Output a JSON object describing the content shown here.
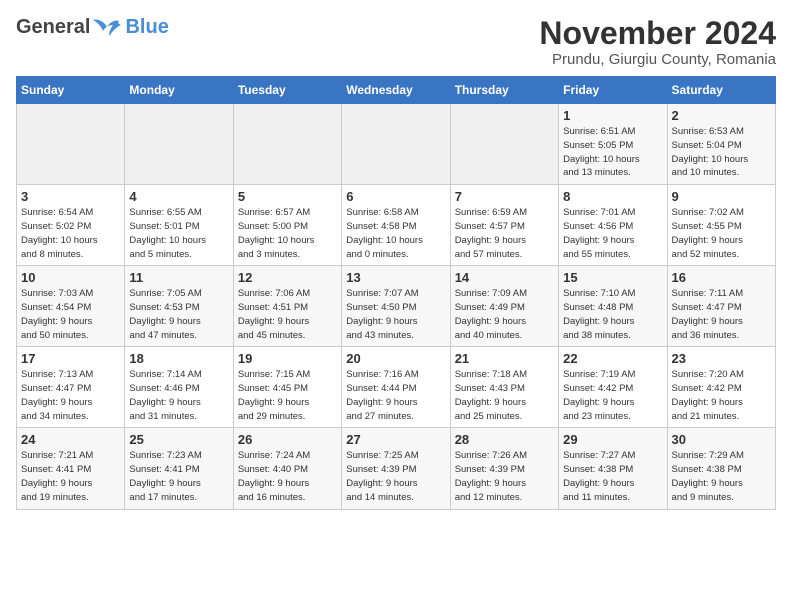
{
  "header": {
    "logo_general": "General",
    "logo_blue": "Blue",
    "month_title": "November 2024",
    "location": "Prundu, Giurgiu County, Romania"
  },
  "weekdays": [
    "Sunday",
    "Monday",
    "Tuesday",
    "Wednesday",
    "Thursday",
    "Friday",
    "Saturday"
  ],
  "weeks": [
    [
      {
        "day": "",
        "info": ""
      },
      {
        "day": "",
        "info": ""
      },
      {
        "day": "",
        "info": ""
      },
      {
        "day": "",
        "info": ""
      },
      {
        "day": "",
        "info": ""
      },
      {
        "day": "1",
        "info": "Sunrise: 6:51 AM\nSunset: 5:05 PM\nDaylight: 10 hours\nand 13 minutes."
      },
      {
        "day": "2",
        "info": "Sunrise: 6:53 AM\nSunset: 5:04 PM\nDaylight: 10 hours\nand 10 minutes."
      }
    ],
    [
      {
        "day": "3",
        "info": "Sunrise: 6:54 AM\nSunset: 5:02 PM\nDaylight: 10 hours\nand 8 minutes."
      },
      {
        "day": "4",
        "info": "Sunrise: 6:55 AM\nSunset: 5:01 PM\nDaylight: 10 hours\nand 5 minutes."
      },
      {
        "day": "5",
        "info": "Sunrise: 6:57 AM\nSunset: 5:00 PM\nDaylight: 10 hours\nand 3 minutes."
      },
      {
        "day": "6",
        "info": "Sunrise: 6:58 AM\nSunset: 4:58 PM\nDaylight: 10 hours\nand 0 minutes."
      },
      {
        "day": "7",
        "info": "Sunrise: 6:59 AM\nSunset: 4:57 PM\nDaylight: 9 hours\nand 57 minutes."
      },
      {
        "day": "8",
        "info": "Sunrise: 7:01 AM\nSunset: 4:56 PM\nDaylight: 9 hours\nand 55 minutes."
      },
      {
        "day": "9",
        "info": "Sunrise: 7:02 AM\nSunset: 4:55 PM\nDaylight: 9 hours\nand 52 minutes."
      }
    ],
    [
      {
        "day": "10",
        "info": "Sunrise: 7:03 AM\nSunset: 4:54 PM\nDaylight: 9 hours\nand 50 minutes."
      },
      {
        "day": "11",
        "info": "Sunrise: 7:05 AM\nSunset: 4:53 PM\nDaylight: 9 hours\nand 47 minutes."
      },
      {
        "day": "12",
        "info": "Sunrise: 7:06 AM\nSunset: 4:51 PM\nDaylight: 9 hours\nand 45 minutes."
      },
      {
        "day": "13",
        "info": "Sunrise: 7:07 AM\nSunset: 4:50 PM\nDaylight: 9 hours\nand 43 minutes."
      },
      {
        "day": "14",
        "info": "Sunrise: 7:09 AM\nSunset: 4:49 PM\nDaylight: 9 hours\nand 40 minutes."
      },
      {
        "day": "15",
        "info": "Sunrise: 7:10 AM\nSunset: 4:48 PM\nDaylight: 9 hours\nand 38 minutes."
      },
      {
        "day": "16",
        "info": "Sunrise: 7:11 AM\nSunset: 4:47 PM\nDaylight: 9 hours\nand 36 minutes."
      }
    ],
    [
      {
        "day": "17",
        "info": "Sunrise: 7:13 AM\nSunset: 4:47 PM\nDaylight: 9 hours\nand 34 minutes."
      },
      {
        "day": "18",
        "info": "Sunrise: 7:14 AM\nSunset: 4:46 PM\nDaylight: 9 hours\nand 31 minutes."
      },
      {
        "day": "19",
        "info": "Sunrise: 7:15 AM\nSunset: 4:45 PM\nDaylight: 9 hours\nand 29 minutes."
      },
      {
        "day": "20",
        "info": "Sunrise: 7:16 AM\nSunset: 4:44 PM\nDaylight: 9 hours\nand 27 minutes."
      },
      {
        "day": "21",
        "info": "Sunrise: 7:18 AM\nSunset: 4:43 PM\nDaylight: 9 hours\nand 25 minutes."
      },
      {
        "day": "22",
        "info": "Sunrise: 7:19 AM\nSunset: 4:42 PM\nDaylight: 9 hours\nand 23 minutes."
      },
      {
        "day": "23",
        "info": "Sunrise: 7:20 AM\nSunset: 4:42 PM\nDaylight: 9 hours\nand 21 minutes."
      }
    ],
    [
      {
        "day": "24",
        "info": "Sunrise: 7:21 AM\nSunset: 4:41 PM\nDaylight: 9 hours\nand 19 minutes."
      },
      {
        "day": "25",
        "info": "Sunrise: 7:23 AM\nSunset: 4:41 PM\nDaylight: 9 hours\nand 17 minutes."
      },
      {
        "day": "26",
        "info": "Sunrise: 7:24 AM\nSunset: 4:40 PM\nDaylight: 9 hours\nand 16 minutes."
      },
      {
        "day": "27",
        "info": "Sunrise: 7:25 AM\nSunset: 4:39 PM\nDaylight: 9 hours\nand 14 minutes."
      },
      {
        "day": "28",
        "info": "Sunrise: 7:26 AM\nSunset: 4:39 PM\nDaylight: 9 hours\nand 12 minutes."
      },
      {
        "day": "29",
        "info": "Sunrise: 7:27 AM\nSunset: 4:38 PM\nDaylight: 9 hours\nand 11 minutes."
      },
      {
        "day": "30",
        "info": "Sunrise: 7:29 AM\nSunset: 4:38 PM\nDaylight: 9 hours\nand 9 minutes."
      }
    ]
  ]
}
